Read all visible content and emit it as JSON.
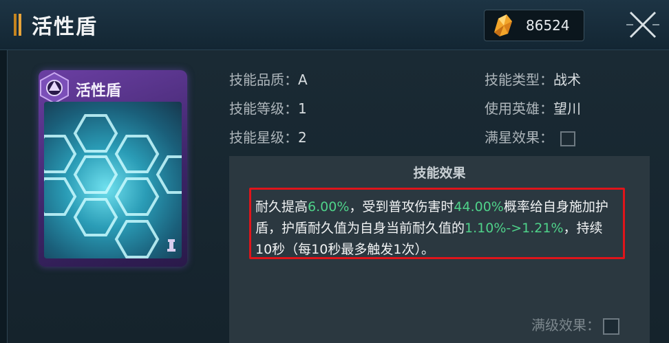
{
  "header": {
    "title": "活性盾",
    "currency_value": "86524",
    "currency_icon": "crystal-icon",
    "close_icon": "close-icon"
  },
  "card": {
    "title": "活性盾",
    "emblem_icon": "hex-emblem-icon"
  },
  "info": {
    "quality_label": "技能品质：",
    "quality_value": "A",
    "level_label": "技能等级：",
    "level_value": "1",
    "star_label": "技能星级：",
    "star_value": "2",
    "type_label": "技能类型：",
    "type_value": "战术",
    "hero_label": "使用英雄：",
    "hero_value": "望川",
    "fullstar_label": "满星效果："
  },
  "effect": {
    "title": "技能效果",
    "t1": "耐久提高",
    "h1": "6.00%",
    "t2": "，受到普攻伤害时",
    "h2": "44.00%",
    "t3": "概率给自身施加护盾，护盾耐久值为自身当前耐久值的",
    "h3": "1.10%->1.21%",
    "t4": "，持续10秒（每10秒最多触发1次）。",
    "maxlevel_label": "满级效果："
  },
  "colors": {
    "accent": "#e7a43b",
    "highlight": "#4fd38a",
    "border_red": "#e0141a",
    "card_purple": "#6b3fa3"
  }
}
